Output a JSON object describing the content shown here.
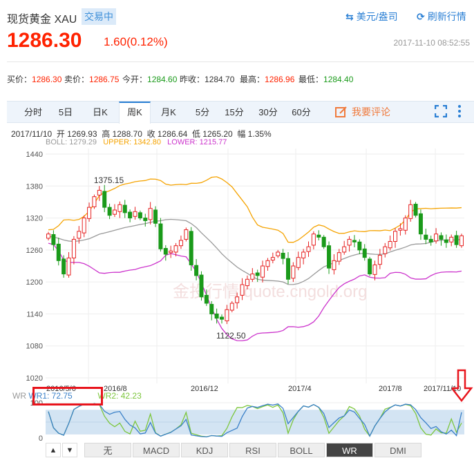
{
  "header": {
    "title": "现货黄金 XAU",
    "status": "交易中",
    "currency_link": "美元/盎司",
    "refresh_link": "刷新行情"
  },
  "quote": {
    "price": "1286.30",
    "change": "1.60(0.12%)",
    "time": "2017-11-10 08:52:55"
  },
  "info": [
    {
      "label": "买价：",
      "value": "1286.30",
      "color": "v"
    },
    {
      "label": "卖价：",
      "value": "1286.75",
      "color": "v"
    },
    {
      "label": "今开：",
      "value": "1284.60",
      "color": "g"
    },
    {
      "label": "昨收：",
      "value": "1284.70",
      "color": "n"
    },
    {
      "label": "最高：",
      "value": "1286.96",
      "color": "v"
    },
    {
      "label": "最低：",
      "value": "1284.40",
      "color": "g"
    }
  ],
  "tabs": [
    "分时",
    "5日",
    "日K",
    "周K",
    "月K",
    "5分",
    "15分",
    "30分",
    "60分"
  ],
  "active_tab": "周K",
  "comment_label": "我要评论",
  "ohlc_line": "2017/11/10  开 1269.93  高 1288.70  收 1286.64  低 1265.20  幅 1.35%",
  "boll": {
    "boll": "BOLL: 1279.29",
    "upper": "UPPER: 1342.80",
    "lower": "LOWER: 1215.77"
  },
  "wr_legend": {
    "name": "WR",
    "wr1": "WR1: 72.75",
    "wr2": "WR2: 42.23"
  },
  "indicator_buttons": [
    "无",
    "MACD",
    "KDJ",
    "RSI",
    "BOLL",
    "WR",
    "DMI"
  ],
  "active_indicator": "WR",
  "scroll_up": "▲",
  "scroll_down": "▼",
  "watermark": "金投行情 quote.cngold.org",
  "colors": {
    "up": "#e62020",
    "down": "#1a9a1a",
    "upper": "#f5a300",
    "lower": "#cc33cc",
    "mid": "#999999",
    "wr1": "#3a80c8",
    "wr2": "#7cc63c"
  },
  "chart_data": {
    "type": "candlestick",
    "ylim": [
      1020,
      1440
    ],
    "yticks": [
      1440,
      1380,
      1320,
      1260,
      1200,
      1140,
      1080,
      1020
    ],
    "xlabels": [
      "2016/5/6",
      "2016/8",
      "2016/12",
      "2017/4",
      "2017/8",
      "2017/11/10"
    ],
    "annotations": [
      {
        "label": "1375.15",
        "value": 1375.15
      },
      {
        "label": "1122.50",
        "value": 1122.5
      }
    ],
    "closes": [
      1290,
      1270,
      1240,
      1215,
      1245,
      1280,
      1295,
      1320,
      1340,
      1360,
      1372,
      1340,
      1325,
      1335,
      1345,
      1330,
      1320,
      1332,
      1320,
      1315,
      1338,
      1310,
      1262,
      1252,
      1258,
      1268,
      1278,
      1298,
      1232,
      1212,
      1172,
      1160,
      1140,
      1132,
      1130,
      1148,
      1160,
      1172,
      1195,
      1205,
      1215,
      1212,
      1230,
      1240,
      1246,
      1256,
      1244,
      1205,
      1230,
      1246,
      1256,
      1266,
      1290,
      1284,
      1266,
      1226,
      1240,
      1255,
      1266,
      1280,
      1275,
      1260,
      1246,
      1215,
      1232,
      1250,
      1266,
      1276,
      1295,
      1300,
      1320,
      1345,
      1325,
      1290,
      1280,
      1275,
      1290,
      1280,
      1274,
      1284,
      1270,
      1286.64
    ],
    "wr_axis": [
      0,
      100
    ],
    "wr_last": {
      "wr1": 72.75,
      "wr2": 42.23
    }
  }
}
